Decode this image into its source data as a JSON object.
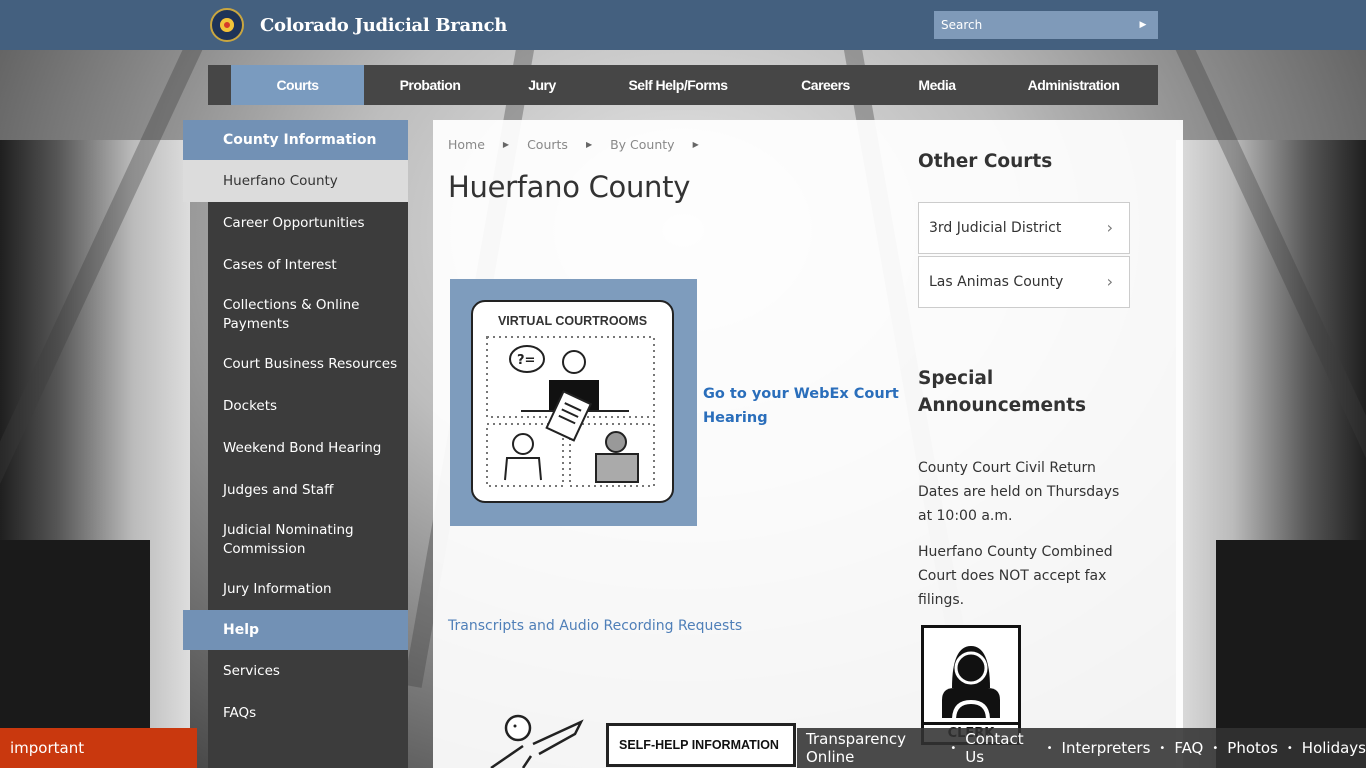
{
  "header": {
    "site_title": "Colorado Judicial Branch",
    "logo_icon": "colorado-courts-seal",
    "search": {
      "placeholder": "Search",
      "button_icon": "arrow-right-icon"
    }
  },
  "main_nav": [
    {
      "label": "Courts",
      "active": true
    },
    {
      "label": "Probation",
      "active": false
    },
    {
      "label": "Jury",
      "active": false
    },
    {
      "label": "Self Help/Forms",
      "active": false
    },
    {
      "label": "Careers",
      "active": false
    },
    {
      "label": "Media",
      "active": false
    },
    {
      "label": "Administration",
      "active": false
    }
  ],
  "sidebar": {
    "section_title": "County Information",
    "current": "Huerfano County",
    "items": [
      "Career Opportunities",
      "Cases of Interest",
      "Collections & Online Payments",
      "Court Business Resources",
      "Dockets",
      "Weekend Bond Hearing",
      "Judges and Staff",
      "Judicial Nominating Commission",
      "Jury Information"
    ],
    "help_title": "Help",
    "help_items": [
      "Services",
      "FAQs"
    ]
  },
  "breadcrumb": [
    "Home",
    "Courts",
    "By County"
  ],
  "page_title": "Huerfano County",
  "virtual_courtrooms": {
    "image_title": "VIRTUAL COURTROOMS",
    "link_text": "Go to your WebEx Court Hearing"
  },
  "transcripts_link": "Transcripts and Audio Recording Requests",
  "self_help_sign": "SELF-HELP INFORMATION",
  "other_courts": {
    "title": "Other Courts",
    "links": [
      "3rd Judicial District",
      "Las Animas County"
    ]
  },
  "special_announcements": {
    "title": "Special Announcements",
    "paragraphs": [
      "County Court Civil Return Dates are held on Thursdays at 10:00 a.m.",
      "Huerfano County Combined Court does NOT accept fax filings."
    ]
  },
  "clerk_icon_label": "CLERK",
  "footer_links": [
    "Transparency Online",
    "Contact Us",
    "Interpreters",
    "FAQ",
    "Photos",
    "Holidays"
  ],
  "announcement_tab": "important announcement",
  "colors": {
    "header_blue": "#44607f",
    "accent_blue": "#7a9bbf",
    "nav_dark": "#464646",
    "announcement_red": "#c9380e",
    "link_blue": "#2a6ebb"
  }
}
